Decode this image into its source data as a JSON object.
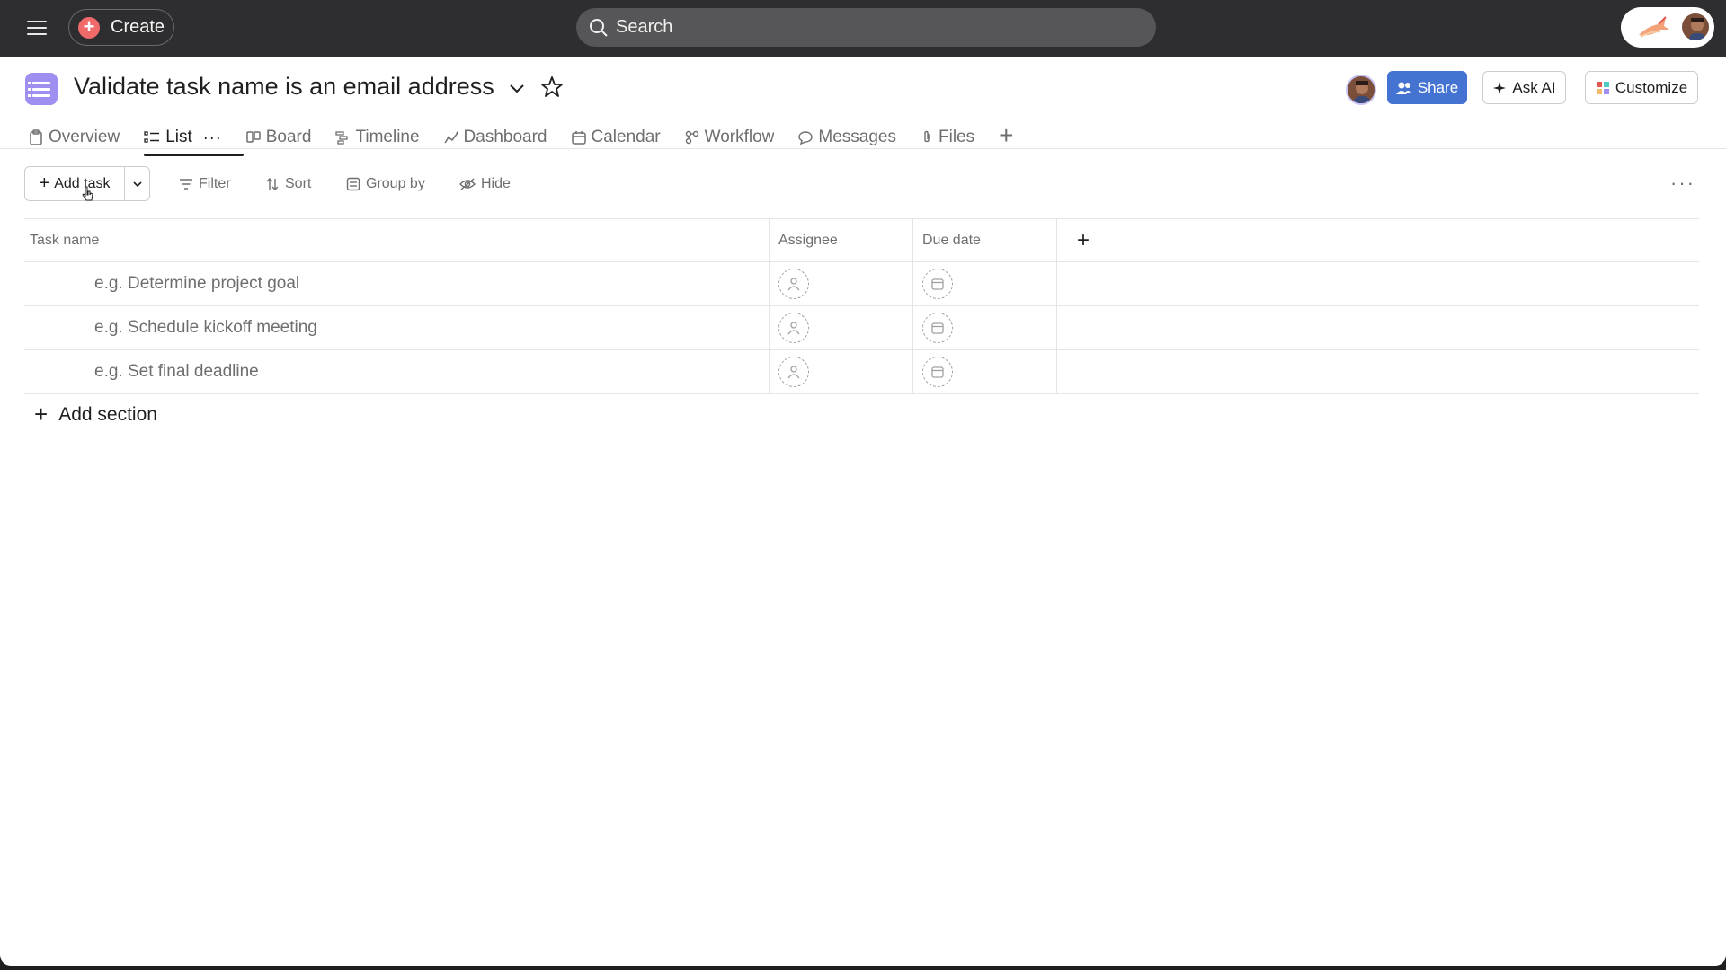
{
  "topbar": {
    "create_label": "Create",
    "search_placeholder": "Search"
  },
  "header": {
    "title": "Validate task name is an email address",
    "share_label": "Share",
    "ask_ai_label": "Ask AI",
    "customize_label": "Customize"
  },
  "tabs": [
    {
      "label": "Overview"
    },
    {
      "label": "List"
    },
    {
      "label": "Board"
    },
    {
      "label": "Timeline"
    },
    {
      "label": "Dashboard"
    },
    {
      "label": "Calendar"
    },
    {
      "label": "Workflow"
    },
    {
      "label": "Messages"
    },
    {
      "label": "Files"
    }
  ],
  "toolbar": {
    "add_task_label": "Add task",
    "filter_label": "Filter",
    "sort_label": "Sort",
    "group_by_label": "Group by",
    "hide_label": "Hide"
  },
  "table": {
    "columns": [
      "Task name",
      "Assignee",
      "Due date"
    ],
    "rows": [
      {
        "name": "e.g. Determine project goal"
      },
      {
        "name": "e.g. Schedule kickoff meeting"
      },
      {
        "name": "e.g. Set final deadline"
      }
    ],
    "add_section_label": "Add section"
  },
  "colors": {
    "topbar_bg": "#2e2e30",
    "create_accent": "#f06a6a",
    "share_bg": "#4573d2",
    "project_icon_bg": "#9f8ff0"
  }
}
